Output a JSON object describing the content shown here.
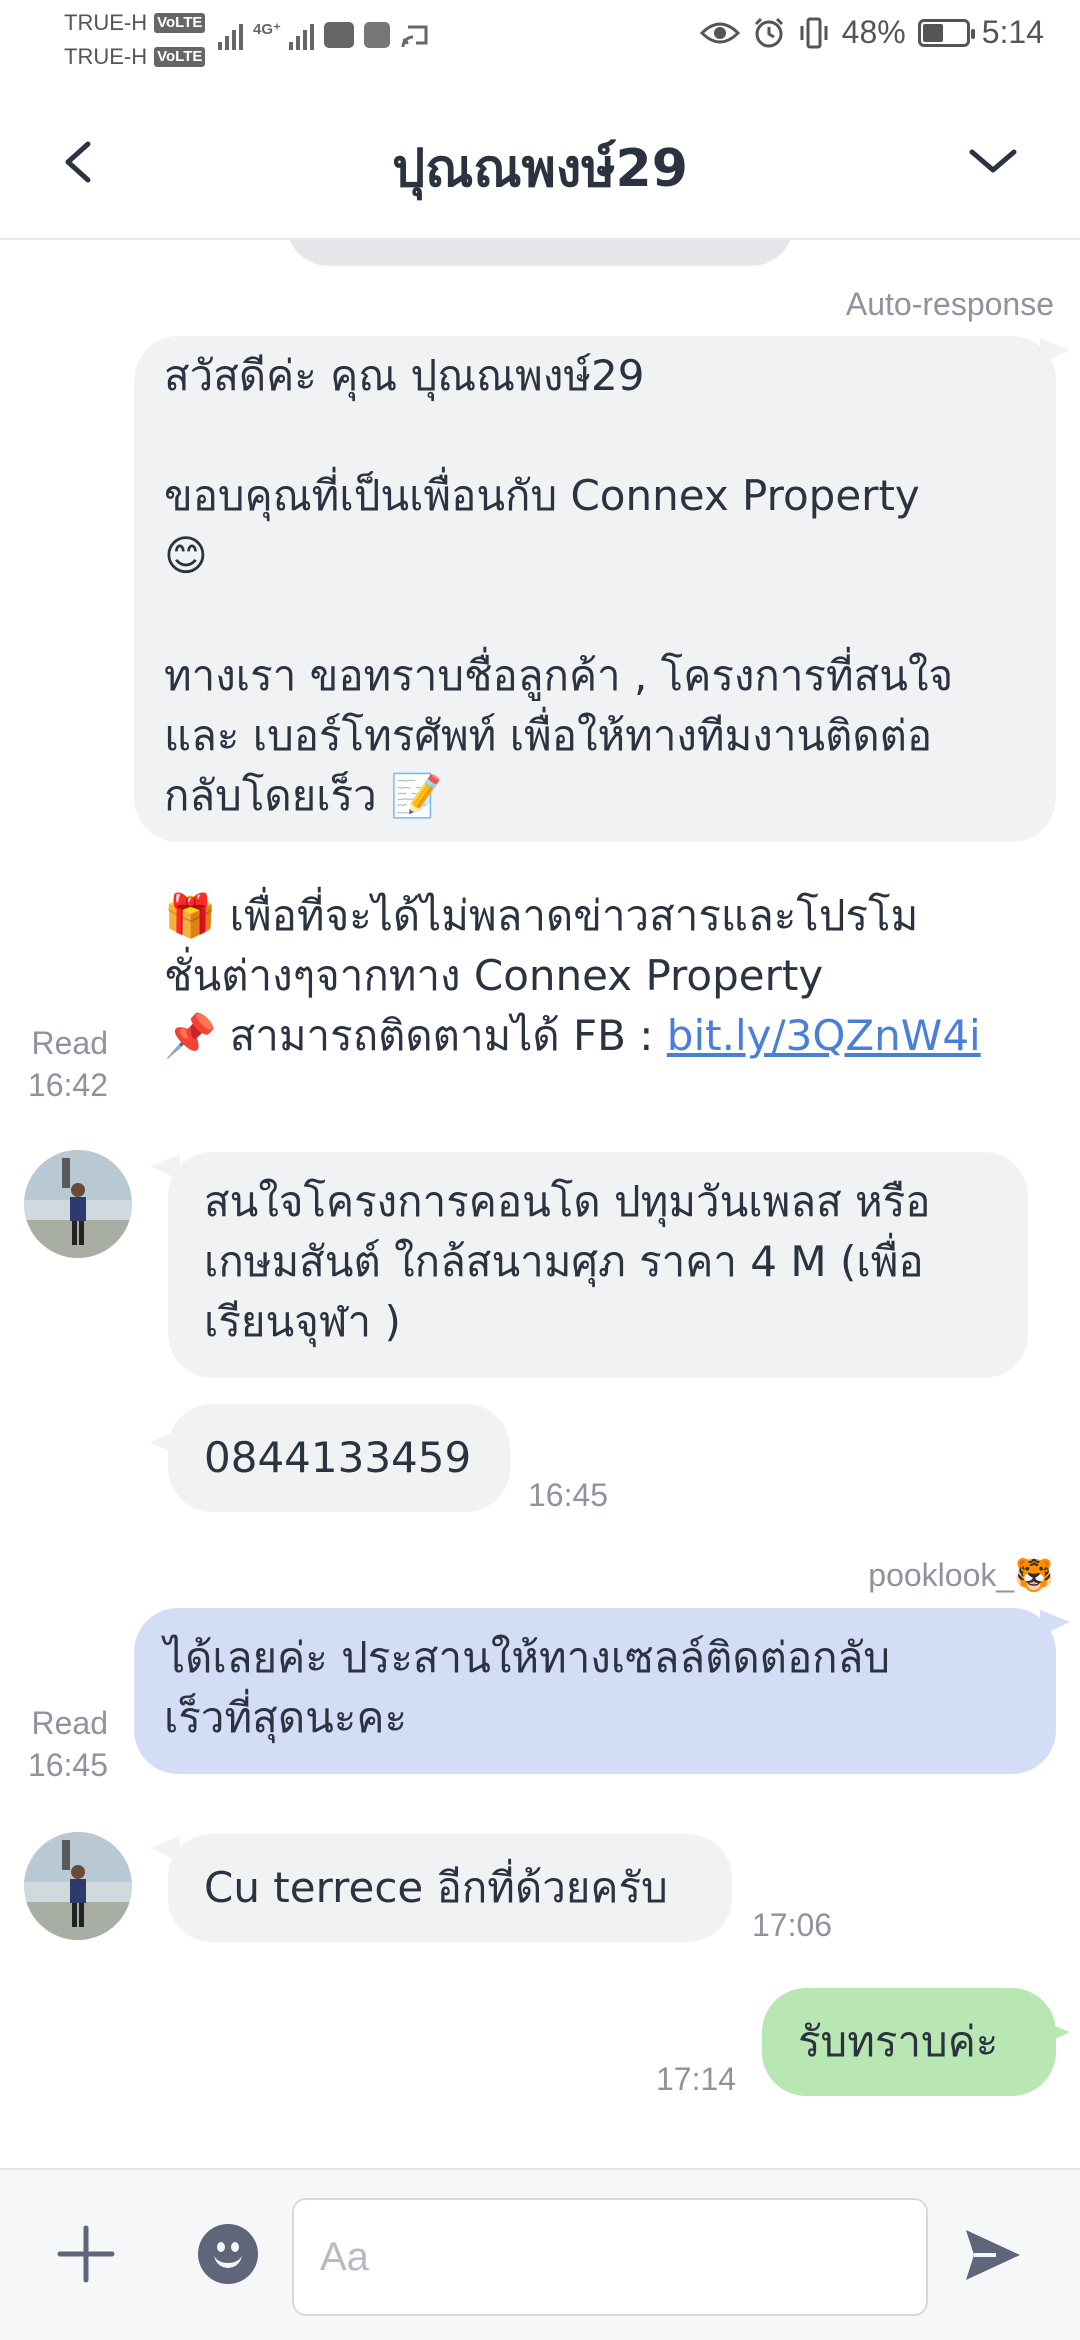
{
  "status_bar": {
    "carrier_1": "TRUE-H",
    "carrier_2": "TRUE-H",
    "volte_label": "VoLTE",
    "network_label": "4G⁺",
    "battery_text": "48%",
    "battery_level": 0.48,
    "time": "5:14"
  },
  "header": {
    "title": "ปุณณพงษ์29",
    "back_icon": "chevron-left-icon",
    "menu_icon": "chevron-down-icon"
  },
  "messages": {
    "auto_label": "Auto-response",
    "msg1_text": "สวัสดีค่ะ คุณ ปุณณพงษ์29\n\nขอบคุณที่เป็นเพื่อนกับ Connex Property\n😊\n\nทางเรา ขอทราบชื่อลูกค้า , โครงการที่สนใจ\nและ เบอร์โทรศัพท์ เพื่อให้ทางทีมงานติดต่อ\nกลับโดยเร็ว 📝\n\n🎁 เพื่อที่จะได้ไม่พลาดข่าวสารและโปรโม\nชั่นต่างๆจากทาง Connex Property\n📌 สามารถติดตามได้ FB : ",
    "msg1_link": "bit.ly/3QZnW4i",
    "msg1_read": "Read",
    "msg1_time": "16:42",
    "msg2_text": "สนใจโครงการคอนโด ปทุมวันเพลส หรือ\nเกษมสันต์ ใกล้สนามศุภ ราคา 4 M (เพื่อ\nเรียนจุฬา )",
    "msg3_text": "0844133459",
    "msg3_time": "16:45",
    "agent_label": "pooklook_🐯",
    "msg4_text": "ได้เลยค่ะ ประสานให้ทางเซลล์ติดต่อกลับ\nเร็วที่สุดนะคะ",
    "msg4_read": "Read",
    "msg4_time": "16:45",
    "msg5_text": "Cu terrece อีกที่ด้วยครับ",
    "msg5_time": "17:06",
    "msg6_text": "รับทราบค่ะ",
    "msg6_time": "17:14"
  },
  "input_bar": {
    "placeholder": "Aa",
    "plus_icon": "plus-icon",
    "emoji_icon": "emoji-icon",
    "send_icon": "send-icon"
  },
  "colors": {
    "incoming_bubble": "#f1f2f4",
    "outgoing_blue": "#d3ddf5",
    "outgoing_green": "#b9e7b3",
    "link": "#4a7fd8"
  }
}
